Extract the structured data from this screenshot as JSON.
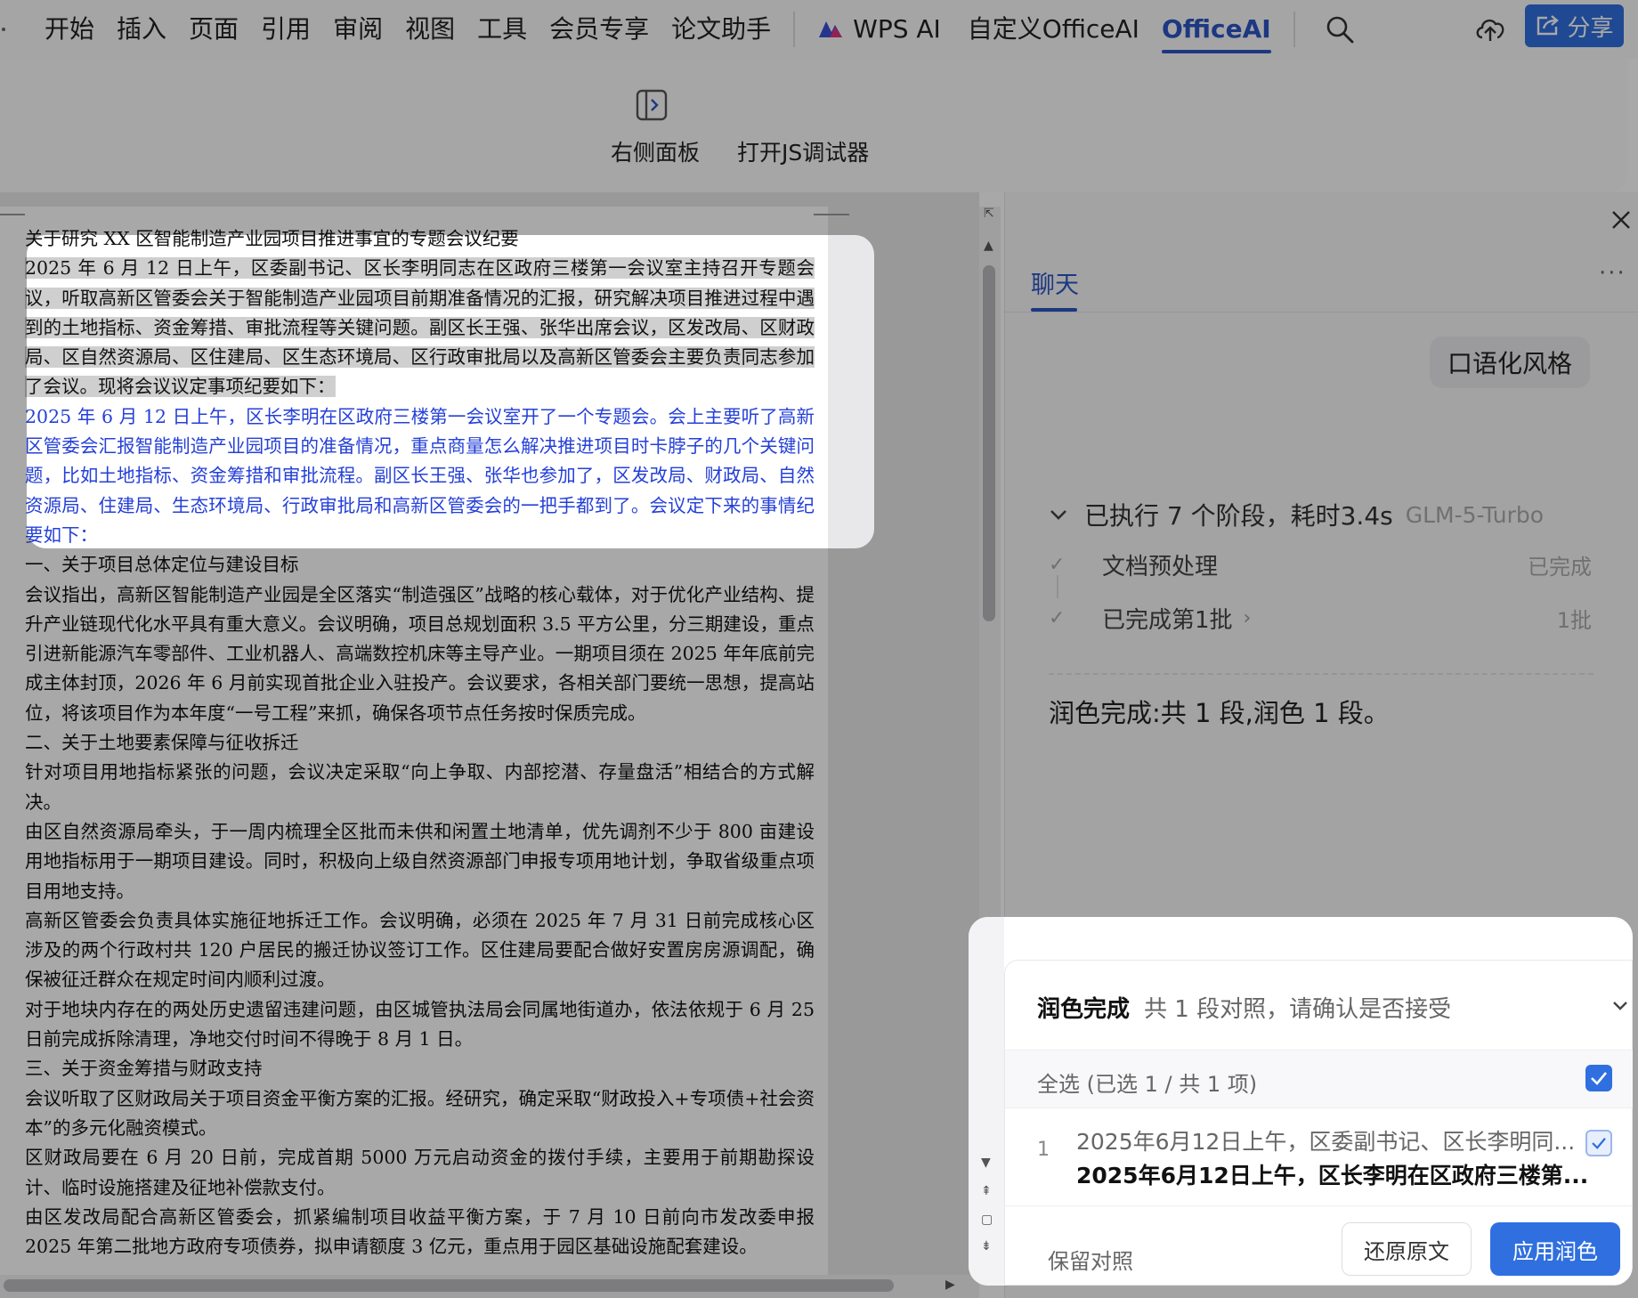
{
  "menu": {
    "items": [
      "开始",
      "插入",
      "页面",
      "引用",
      "审阅",
      "视图",
      "工具",
      "会员专享",
      "论文助手"
    ],
    "wps_ai": "WPS AI",
    "custom_ai": "自定义OfficeAI",
    "office_ai": "OfficeAI",
    "share": "分享"
  },
  "ribbon": {
    "right_panel": "右侧面板",
    "js_debugger": "打开JS调试器"
  },
  "document": {
    "title": "关于研究 XX 区智能制造产业园项目推进事宜的专题会议纪要",
    "original_paragraph": "2025 年 6 月 12 日上午，区委副书记、区长李明同志在区政府三楼第一会议室主持召开专题会议，听取高新区管委会关于智能制造产业园项目前期准备情况的汇报，研究解决项目推进过程中遇到的土地指标、资金筹措、审批流程等关键问题。副区长王强、张华出席会议，区发改局、区财政局、区自然资源局、区住建局、区生态环境局、区行政审批局以及高新区管委会主要负责同志参加了会议。现将会议议定事项纪要如下：",
    "polished_paragraph": "2025 年 6 月 12 日上午，区长李明在区政府三楼第一会议室开了一个专题会。会上主要听了高新区管委会汇报智能制造产业园项目的准备情况，重点商量怎么解决推进项目时卡脖子的几个关键问题，比如土地指标、资金筹措和审批流程。副区长王强、张华也参加了，区发改局、财政局、自然资源局、住建局、生态环境局、行政审批局和高新区管委会的一把手都到了。会议定下来的事情纪要如下：",
    "paragraphs": [
      "一、关于项目总体定位与建设目标",
      "会议指出，高新区智能制造产业园是全区落实“制造强区”战略的核心载体，对于优化产业结构、提升产业链现代化水平具有重大意义。会议明确，项目总规划面积 3.5 平方公里，分三期建设，重点引进新能源汽车零部件、工业机器人、高端数控机床等主导产业。一期项目须在 2025 年年底前完成主体封顶，2026 年 6 月前实现首批企业入驻投产。会议要求，各相关部门要统一思想，提高站位，将该项目作为本年度“一号工程”来抓，确保各项节点任务按时保质完成。",
      "二、关于土地要素保障与征收拆迁",
      "针对项目用地指标紧张的问题，会议决定采取“向上争取、内部挖潜、存量盘活”相结合的方式解决。",
      "由区自然资源局牵头，于一周内梳理全区批而未供和闲置土地清单，优先调剂不少于 800 亩建设用地指标用于一期项目建设。同时，积极向上级自然资源部门申报专项用地计划，争取省级重点项目用地支持。",
      "高新区管委会负责具体实施征地拆迁工作。会议明确，必须在 2025 年 7 月 31 日前完成核心区涉及的两个行政村共 120 户居民的搬迁协议签订工作。区住建局要配合做好安置房房源调配，确保被征迁群众在规定时间内顺利过渡。",
      "对于地块内存在的两处历史遗留违建问题，由区城管执法局会同属地街道办，依法依规于 6 月 25 日前完成拆除清理，净地交付时间不得晚于 8 月 1 日。",
      "三、关于资金筹措与财政支持",
      "会议听取了区财政局关于项目资金平衡方案的汇报。经研究，确定采取“财政投入+专项债+社会资本”的多元化融资模式。",
      "区财政局要在 6 月 20 日前，完成首期 5000 万元启动资金的拨付手续，主要用于前期勘探设计、临时设施搭建及征地补偿款支付。",
      "由区发改局配合高新区管委会，抓紧编制项目收益平衡方案，于 7 月 10 日前向市发改委申报 2025 年第二批地方政府专项债券，拟申请额度 3 亿元，重点用于园区基础设施配套建设。"
    ]
  },
  "panel": {
    "tab_chat": "聊天",
    "more": "···",
    "user_bubble": "口语化风格",
    "exec_summary": "已执行 7 个阶段，耗时3.4s",
    "model": "GLM-5-Turbo",
    "stages": [
      {
        "label": "文档预处理",
        "status": "已完成"
      },
      {
        "label": "已完成第1批",
        "status": "1批"
      }
    ],
    "done_message": "润色完成:共 1 段,润色 1 段。"
  },
  "result_card": {
    "title": "润色完成",
    "subtitle": "共 1 段对照，请确认是否接受",
    "select_all": "全选 (已选 1 / 共 1 项)",
    "item_number": "1",
    "item_original": "2025年6月12日上午，区委副书记、区长李明同...",
    "item_polished": "2025年6月12日上午，区长李明在区政府三楼第...",
    "keep_compare": "保留对照",
    "restore": "还原原文",
    "apply": "应用润色"
  },
  "colors": {
    "accent": "#2f6fe0",
    "polished_text": "#2540d8"
  }
}
